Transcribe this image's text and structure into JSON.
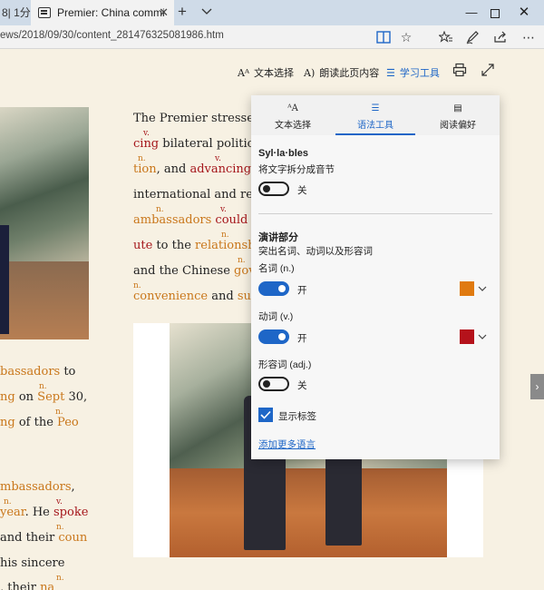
{
  "browser": {
    "prev_tab_title": "8| 1分",
    "active_tab_title": "Premier: China committ",
    "url": "ews/2018/09/30/content_281476325081986.htm"
  },
  "reader_toolbar": {
    "text_options": "文本选择",
    "read_aloud": "朗读此页内容",
    "learning_tools": "学习工具"
  },
  "article": {
    "lines": {
      "l1": "The Premier stresse",
      "l2a": "cing",
      "l2b": " bilateral politic",
      "l3a": "tion",
      "l3b": ", and ",
      "l3c": "advancing",
      "l4": "international and re",
      "l5a": "ambassadors",
      "l5b": " could",
      "l6a": "ute",
      "l6b": " to the ",
      "l6c": "relationsh",
      "l7a": "and the Chinese ",
      "l7b": "gov",
      "l8a": "convenience",
      "l8b": " and ",
      "l8c": "su"
    },
    "left_lines": {
      "a1a": "bassadors",
      "a1b": " to",
      "a2a": "ng",
      "a2b": " on ",
      "a2c": "Sept",
      "a2d": " 30,",
      "a3a": "ng",
      "a3b": " of the ",
      "a3c": "Peo",
      "a4a": "mbassadors",
      "a4b": ",",
      "a5a": "year",
      "a5b": ". He ",
      "a5c": "spoke",
      "a6a": "and their ",
      "a6b": "coun",
      "a7": "his sincere",
      "a8a": ", their ",
      "a8b": "na"
    },
    "tags": {
      "noun": "n.",
      "verb": "v."
    }
  },
  "panel": {
    "tabs": [
      "文本选择",
      "语法工具",
      "阅读偏好"
    ],
    "active_tab_index": 1,
    "syllables_title": "Syl·la·bles",
    "syllables_desc": "将文字拆分成音节",
    "syllables_state": "关",
    "parts_title": "演讲部分",
    "parts_desc": "突出名词、动词以及形容词",
    "noun_label": "名词 (n.)",
    "noun_state": "开",
    "noun_color": "#e07a10",
    "verb_label": "动词 (v.)",
    "verb_state": "开",
    "verb_color": "#b5121b",
    "adj_label": "形容词 (adj.)",
    "adj_state": "关",
    "show_labels": "显示标签",
    "add_languages": "添加更多语言"
  }
}
